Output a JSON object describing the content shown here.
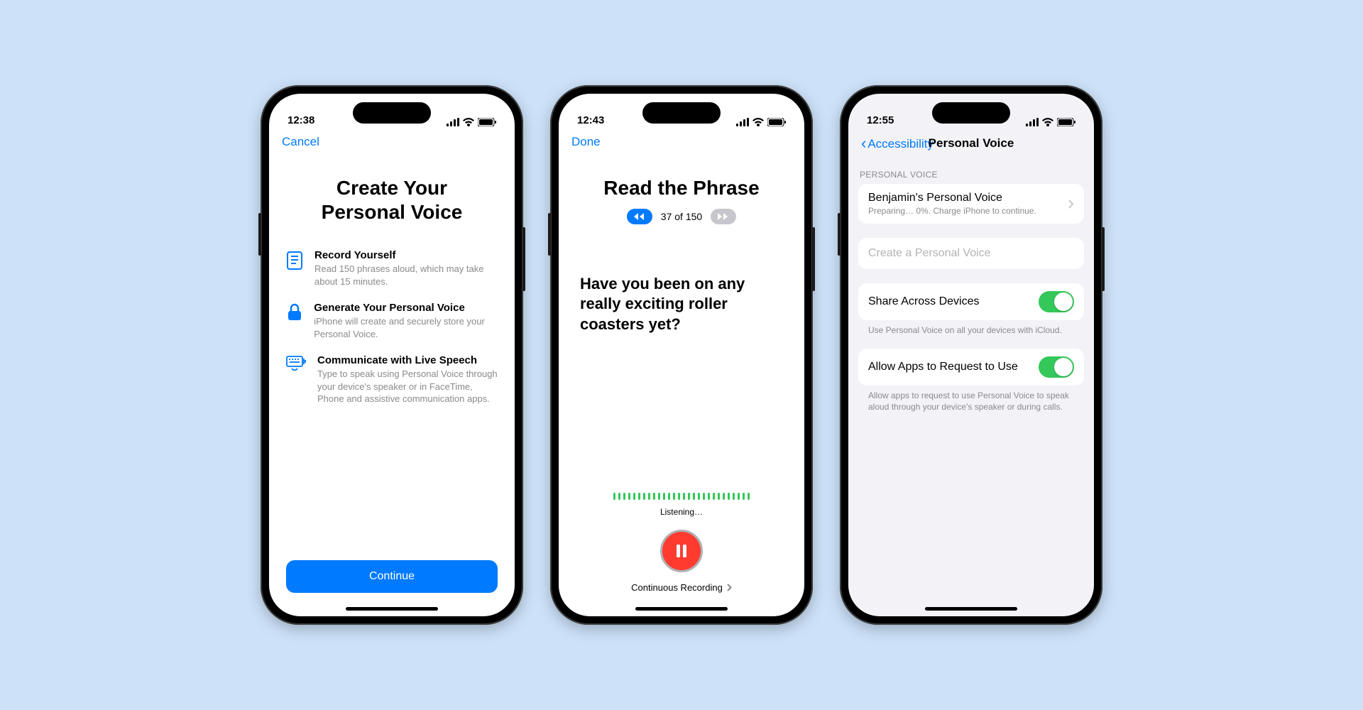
{
  "phone1": {
    "time": "12:38",
    "nav_cancel": "Cancel",
    "title": "Create Your Personal Voice",
    "features": [
      {
        "title": "Record Yourself",
        "body": "Read 150 phrases aloud, which may take about 15 minutes."
      },
      {
        "title": "Generate Your Personal Voice",
        "body": "iPhone will create and securely store your Personal Voice."
      },
      {
        "title": "Communicate with Live Speech",
        "body": "Type to speak using Personal Voice through your device's speaker or in FaceTime, Phone and assistive communication apps."
      }
    ],
    "continue": "Continue"
  },
  "phone2": {
    "time": "12:43",
    "nav_done": "Done",
    "title": "Read the Phrase",
    "counter": "37 of 150",
    "phrase": "Have you been on any really exciting roller coasters yet?",
    "listening": "Listening…",
    "recording_mode": "Continuous Recording"
  },
  "phone3": {
    "time": "12:55",
    "nav_back": "Accessibility",
    "nav_title": "Personal Voice",
    "section_header": "PERSONAL VOICE",
    "voice_name": "Benjamin's Personal Voice",
    "voice_status": "Preparing… 0%. Charge iPhone to continue.",
    "create_label": "Create a Personal Voice",
    "share_label": "Share Across Devices",
    "share_footer": "Use Personal Voice on all your devices with iCloud.",
    "allow_label": "Allow Apps to Request to Use",
    "allow_footer": "Allow apps to request to use Personal Voice to speak aloud through your device's speaker or during calls."
  }
}
